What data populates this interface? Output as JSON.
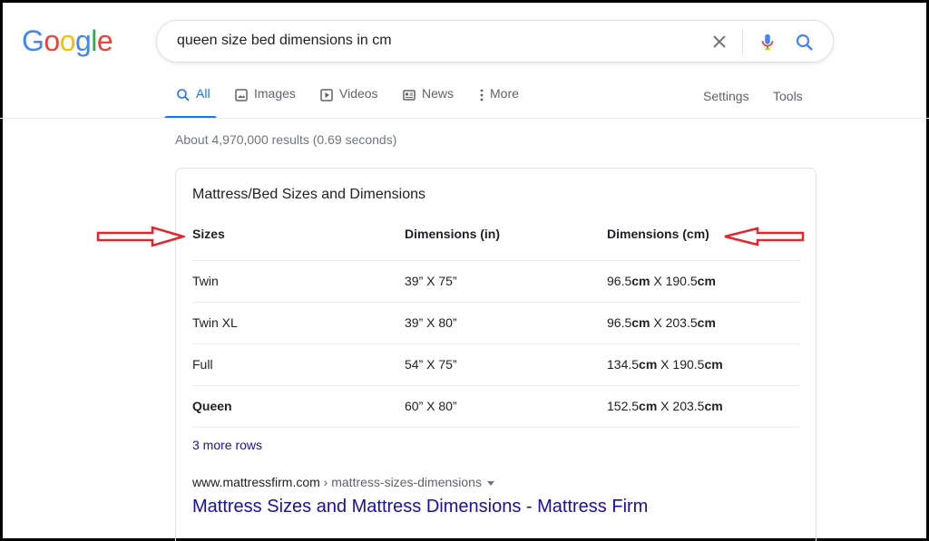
{
  "logo": {
    "letters": [
      "G",
      "o",
      "o",
      "g",
      "l",
      "e"
    ],
    "colors": [
      "#4285F4",
      "#EA4335",
      "#FBBC05",
      "#4285F4",
      "#34A853",
      "#EA4335"
    ]
  },
  "search": {
    "query": "queen size bed dimensions in cm",
    "icons": [
      "clear-icon",
      "mic-icon",
      "search-icon"
    ]
  },
  "tabs": [
    {
      "label": "All",
      "icon": "search-icon"
    },
    {
      "label": "Images",
      "icon": "image-icon"
    },
    {
      "label": "Videos",
      "icon": "video-icon"
    },
    {
      "label": "News",
      "icon": "news-icon"
    },
    {
      "label": "More",
      "icon": "more-vert-icon"
    }
  ],
  "tools": {
    "settings": "Settings",
    "tools": "Tools"
  },
  "stats": "About 4,970,000 results (0.69 seconds)",
  "snippet": {
    "title": "Mattress/Bed Sizes and Dimensions",
    "headers": [
      "Sizes",
      "Dimensions (in)",
      "Dimensions (cm)"
    ],
    "rows": [
      {
        "size": "Twin",
        "inches": "39” X 75”",
        "cm_a": "96.5",
        "cm_b": "190.5"
      },
      {
        "size": "Twin XL",
        "inches": "39” X 80”",
        "cm_a": "96.5",
        "cm_b": "203.5"
      },
      {
        "size": "Full",
        "inches": "54” X 75”",
        "cm_a": "134.5",
        "cm_b": "190.5"
      },
      {
        "size": "Queen",
        "inches": "60” X 80”",
        "cm_a": "152.5",
        "cm_b": "203.5"
      }
    ],
    "unit": "cm",
    "times": " X ",
    "more_rows": "3 more rows"
  },
  "result": {
    "domain": "www.mattressfirm.com",
    "path": " › mattress-sizes-dimensions",
    "title": "Mattress Sizes and Mattress Dimensions - Mattress Firm"
  },
  "colors": {
    "accent": "#1a73e8",
    "link": "#1a0dab",
    "annotation": "#e3262b"
  }
}
